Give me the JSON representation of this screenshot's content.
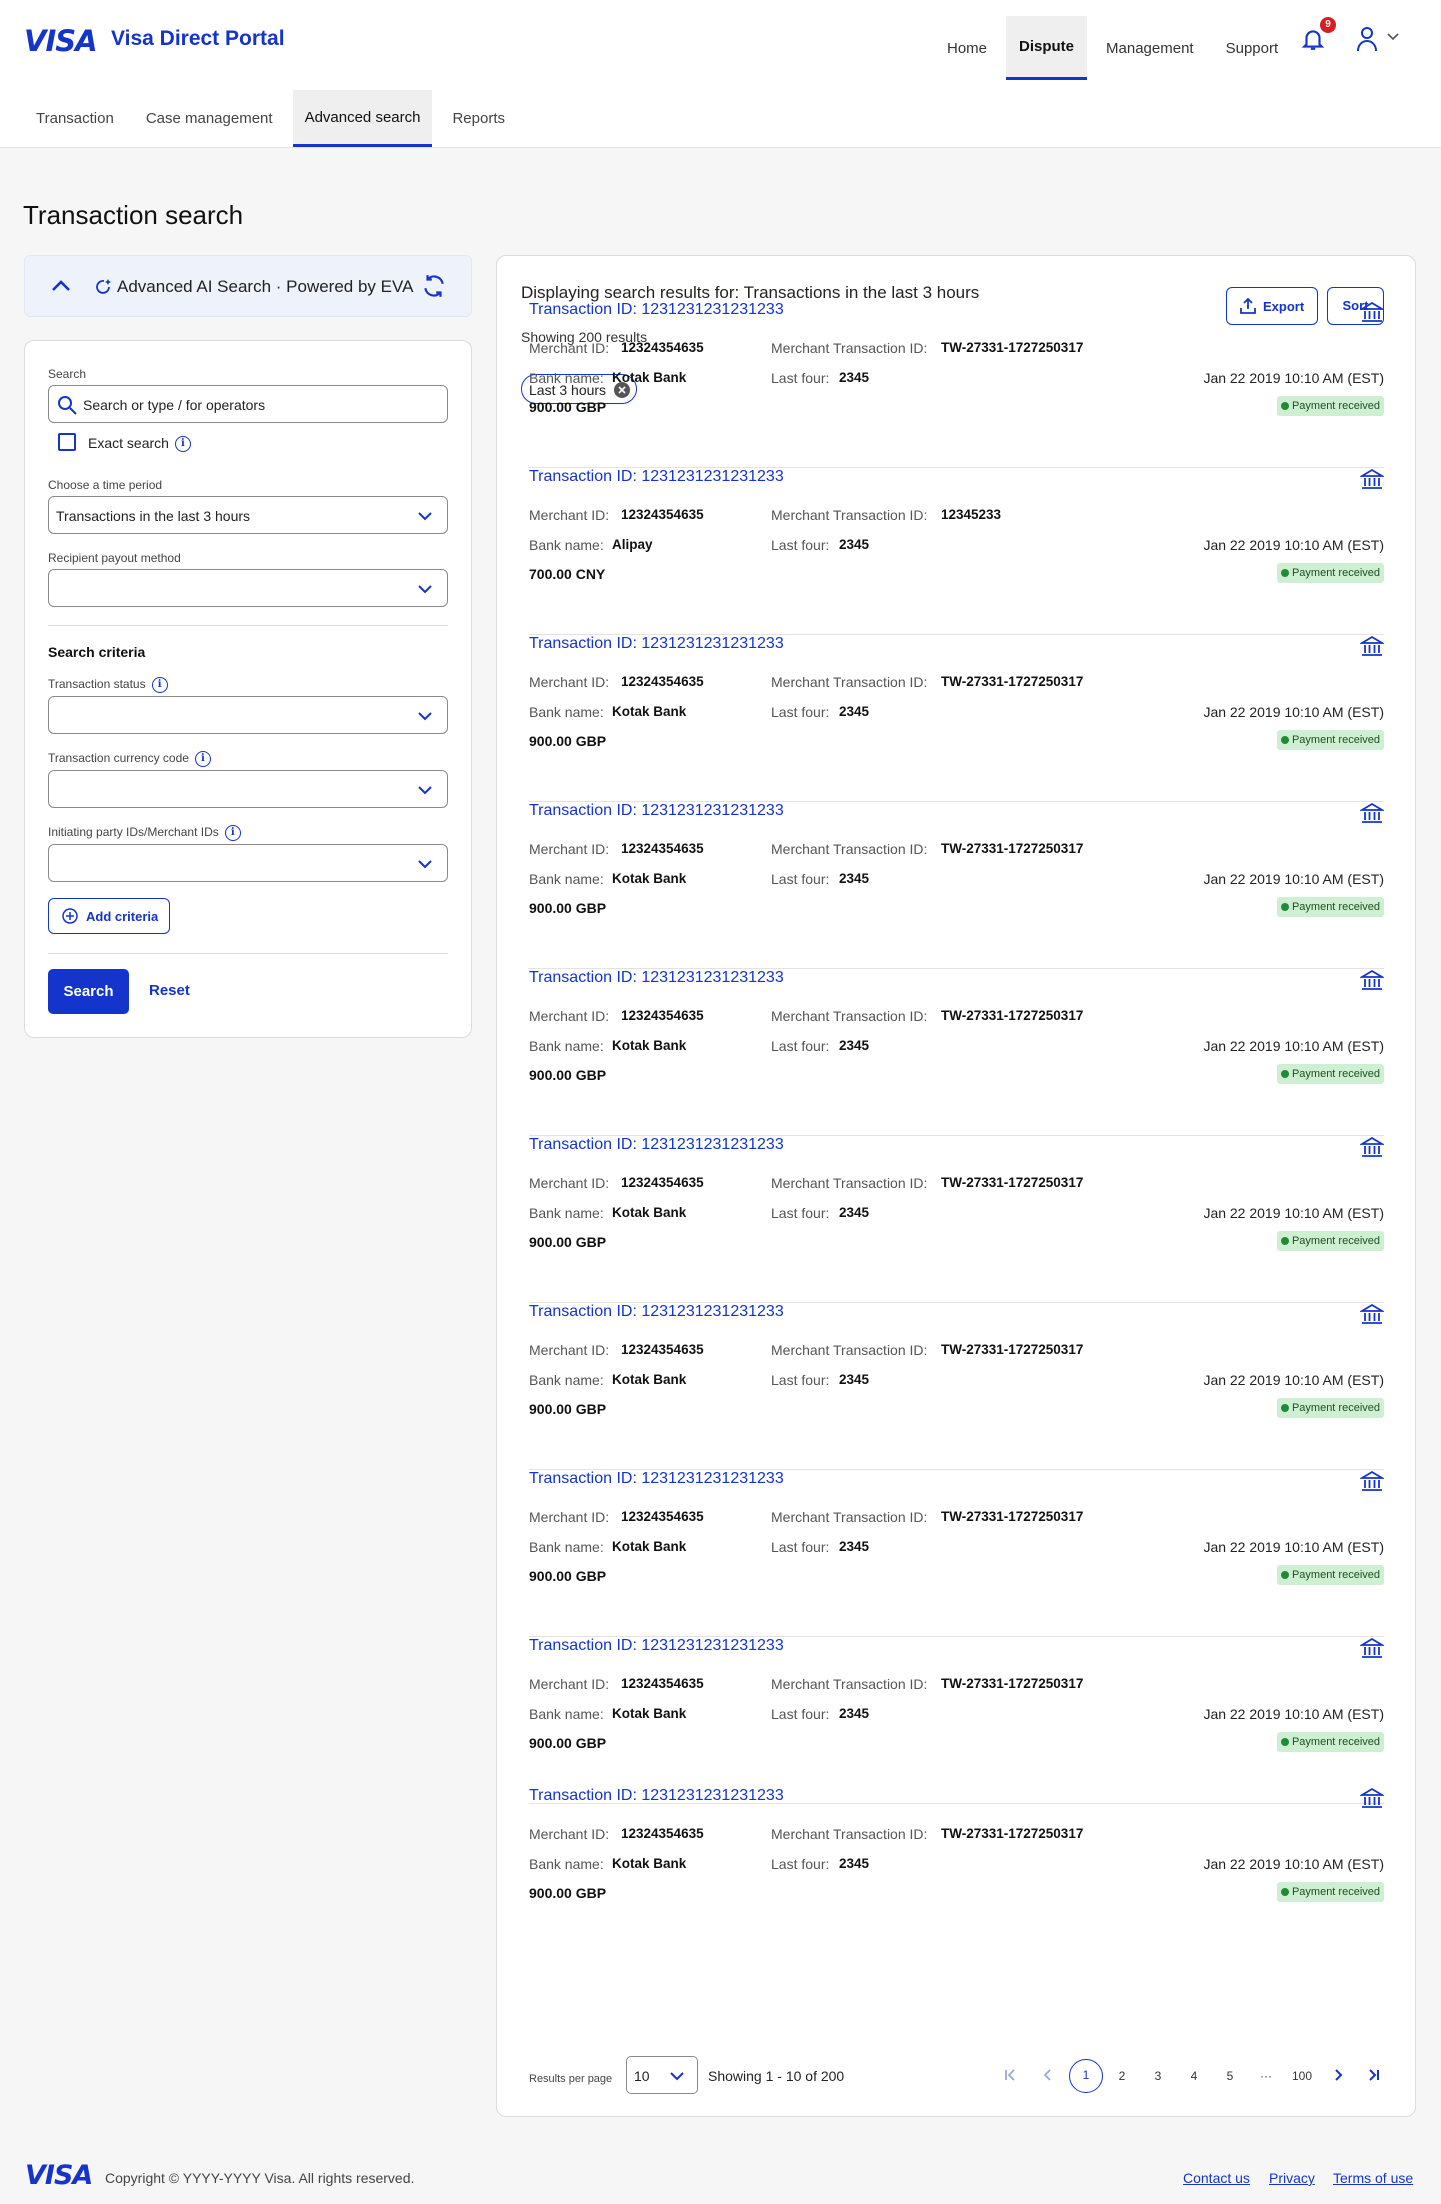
{
  "header": {
    "logo": "VISA",
    "portal_title": "Visa Direct Portal",
    "nav": [
      {
        "label": "Home"
      },
      {
        "label": "Dispute"
      },
      {
        "label": "Management"
      },
      {
        "label": "Support"
      }
    ],
    "active_nav": "Dispute",
    "notification_count": "9"
  },
  "subnav": {
    "tabs": [
      {
        "label": "Transaction"
      },
      {
        "label": "Case management"
      },
      {
        "label": "Advanced search"
      },
      {
        "label": "Reports"
      }
    ],
    "active_tab": "Advanced search"
  },
  "page_title": "Transaction search",
  "ai_search": {
    "label": "Advanced AI Search · Powered by EVA"
  },
  "filters": {
    "search_label": "Search",
    "search_placeholder": "Search or type / for operators",
    "exact_search_label": "Exact search",
    "time_period_label": "Choose a time period",
    "time_period_value": "Transactions in the last 3 hours",
    "payout_label": "Recipient payout method",
    "payout_value": "",
    "criteria_heading": "Search criteria",
    "status_label": "Transaction status",
    "currency_label": "Transaction currency code",
    "party_label": "Initiating party IDs/Merchant IDs",
    "add_criteria": "Add criteria",
    "search_button": "Search",
    "reset_button": "Reset"
  },
  "results": {
    "heading": "Displaying search results for: Transactions in the last 3 hours",
    "count_text": "Showing 200 results",
    "export_label": "Export",
    "sort_label": "Sort",
    "chip_label": "Last 3 hours",
    "labels": {
      "merchant_id": "Merchant ID:",
      "merchant_txn_id": "Merchant Transaction ID:",
      "bank_name": "Bank name:",
      "last_four": "Last four:"
    },
    "transactions": [
      {
        "title": "Transaction ID: 1231231231231233",
        "merchant_id": "12324354635",
        "merchant_txn_id": "TW-27331-1727250317",
        "bank": "Kotak Bank",
        "last_four": "2345",
        "date": "Jan 22 2019 10:10 AM (EST)",
        "amount": "900.00 GBP",
        "status": "Payment received"
      },
      {
        "title": "Transaction ID: 1231231231231233",
        "merchant_id": "12324354635",
        "merchant_txn_id": "12345233",
        "bank": "Alipay",
        "last_four": "2345",
        "date": "Jan 22 2019 10:10 AM (EST)",
        "amount": "700.00 CNY",
        "status": "Payment received"
      },
      {
        "title": "Transaction ID: 1231231231231233",
        "merchant_id": "12324354635",
        "merchant_txn_id": "TW-27331-1727250317",
        "bank": "Kotak Bank",
        "last_four": "2345",
        "date": "Jan 22 2019 10:10 AM (EST)",
        "amount": "900.00 GBP",
        "status": "Payment received"
      },
      {
        "title": "Transaction ID: 1231231231231233",
        "merchant_id": "12324354635",
        "merchant_txn_id": "TW-27331-1727250317",
        "bank": "Kotak Bank",
        "last_four": "2345",
        "date": "Jan 22 2019 10:10 AM (EST)",
        "amount": "900.00 GBP",
        "status": "Payment received"
      },
      {
        "title": "Transaction ID: 1231231231231233",
        "merchant_id": "12324354635",
        "merchant_txn_id": "TW-27331-1727250317",
        "bank": "Kotak Bank",
        "last_four": "2345",
        "date": "Jan 22 2019 10:10 AM (EST)",
        "amount": "900.00 GBP",
        "status": "Payment received"
      },
      {
        "title": "Transaction ID: 1231231231231233",
        "merchant_id": "12324354635",
        "merchant_txn_id": "TW-27331-1727250317",
        "bank": "Kotak Bank",
        "last_four": "2345",
        "date": "Jan 22 2019 10:10 AM (EST)",
        "amount": "900.00 GBP",
        "status": "Payment received"
      },
      {
        "title": "Transaction ID: 1231231231231233",
        "merchant_id": "12324354635",
        "merchant_txn_id": "TW-27331-1727250317",
        "bank": "Kotak Bank",
        "last_four": "2345",
        "date": "Jan 22 2019 10:10 AM (EST)",
        "amount": "900.00 GBP",
        "status": "Payment received"
      },
      {
        "title": "Transaction ID: 1231231231231233",
        "merchant_id": "12324354635",
        "merchant_txn_id": "TW-27331-1727250317",
        "bank": "Kotak Bank",
        "last_four": "2345",
        "date": "Jan 22 2019 10:10 AM (EST)",
        "amount": "900.00 GBP",
        "status": "Payment received"
      },
      {
        "title": "Transaction ID: 1231231231231233",
        "merchant_id": "12324354635",
        "merchant_txn_id": "TW-27331-1727250317",
        "bank": "Kotak Bank",
        "last_four": "2345",
        "date": "Jan 22 2019 10:10 AM (EST)",
        "amount": "900.00 GBP",
        "status": "Payment received"
      },
      {
        "title": "Transaction ID: 1231231231231233",
        "merchant_id": "12324354635",
        "merchant_txn_id": "TW-27331-1727250317",
        "bank": "Kotak Bank",
        "last_four": "2345",
        "date": "Jan 22 2019 10:10 AM (EST)",
        "amount": "900.00 GBP",
        "status": "Payment received"
      }
    ]
  },
  "pagination": {
    "per_page_label": "Results per page",
    "per_page_value": "10",
    "showing": "Showing 1 - 10 of 200",
    "pages": [
      "1",
      "2",
      "3",
      "4",
      "5",
      "···",
      "100"
    ],
    "current_page": "1"
  },
  "footer": {
    "logo": "VISA",
    "copyright": "Copyright © YYYY-YYYY Visa. All rights reserved.",
    "links": [
      {
        "label": "Contact us"
      },
      {
        "label": "Privacy"
      },
      {
        "label": "Terms of use"
      }
    ]
  },
  "colors": {
    "brand": "#1434cb",
    "status_bg": "#cfefd3",
    "badge": "#d42020"
  }
}
